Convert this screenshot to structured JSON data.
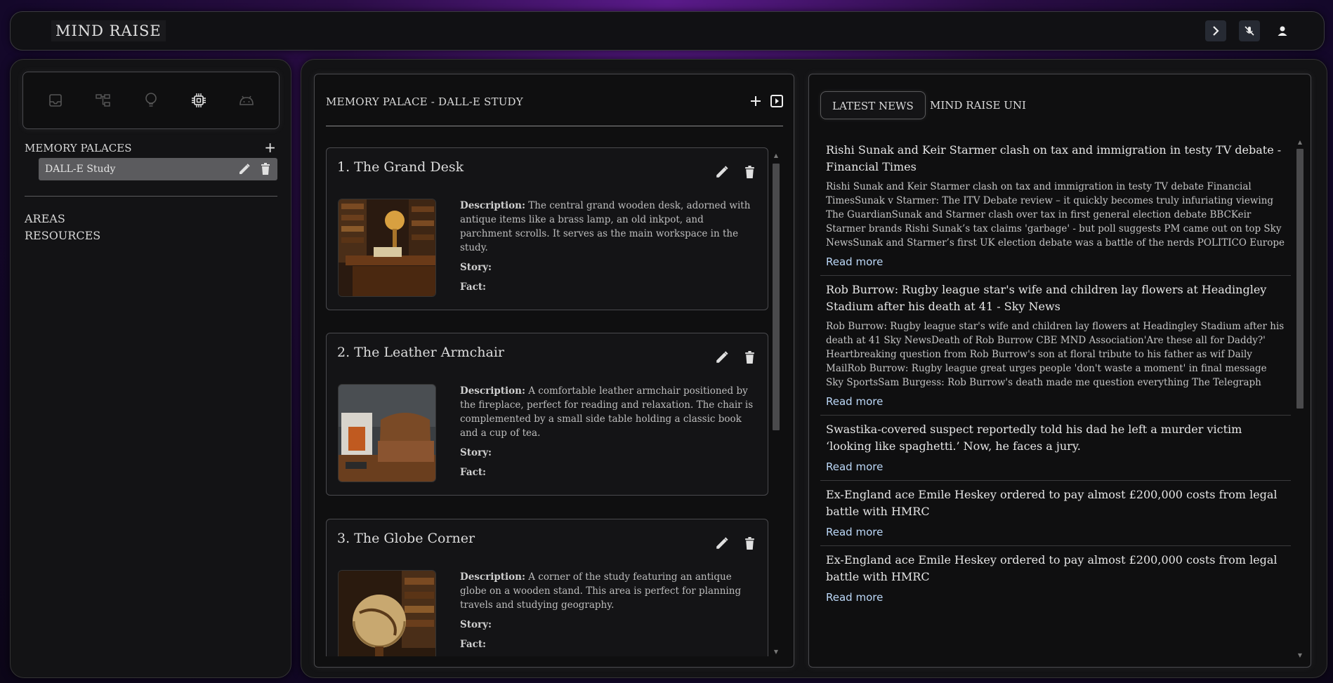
{
  "header": {
    "brand": "MIND RAISE",
    "icons": [
      "chevron-right-icon",
      "mic-off-icon",
      "user-icon"
    ]
  },
  "sidebar": {
    "icons": [
      "inbox-icon",
      "tree-icon",
      "bulb-icon",
      "chip-icon",
      "android-icon"
    ],
    "memory_palaces_label": "MEMORY PALACES",
    "palaces": [
      {
        "label": "DALL-E Study"
      }
    ],
    "areas_label": "AREAS",
    "resources_label": "RESOURCES"
  },
  "palace": {
    "title": "MEMORY PALACE - DALL-E STUDY",
    "description_label": "Description:",
    "story_label": "Story:",
    "fact_label": "Fact:",
    "loci": [
      {
        "title": "1. The Grand Desk",
        "description": "The central grand wooden desk, adorned with antique items like a brass lamp, an old inkpot, and parchment scrolls. It serves as the main workspace in the study.",
        "story": "",
        "fact": ""
      },
      {
        "title": "2. The Leather Armchair",
        "description": "A comfortable leather armchair positioned by the fireplace, perfect for reading and relaxation. The chair is complemented by a small side table holding a classic book and a cup of tea.",
        "story": "",
        "fact": ""
      },
      {
        "title": "3. The Globe Corner",
        "description": "A corner of the study featuring an antique globe on a wooden stand. This area is perfect for planning travels and studying geography.",
        "story": "",
        "fact": ""
      }
    ]
  },
  "news": {
    "tabs": [
      "LATEST NEWS",
      "MIND RAISE UNI"
    ],
    "read_more": "Read more",
    "items": [
      {
        "title": "Rishi Sunak and Keir Starmer clash on tax and immigration in testy TV debate - Financial Times",
        "desc": "Rishi Sunak and Keir Starmer clash on tax and immigration in testy TV debate Financial TimesSunak v Starmer: The ITV Debate review – it quickly becomes truly infuriating viewing The GuardianSunak and Starmer clash over tax in first general election debate BBCKeir Starmer brands Rishi Sunak’s tax claims 'garbage' - but poll suggests PM came out on top Sky NewsSunak and Starmer’s first UK election debate was a battle of the nerds POLITICO Europe"
      },
      {
        "title": "Rob Burrow: Rugby league star's wife and children lay flowers at Headingley Stadium after his death at 41 - Sky News",
        "desc": "Rob Burrow: Rugby league star's wife and children lay flowers at Headingley Stadium after his death at 41 Sky NewsDeath of Rob Burrow CBE MND Association'Are these all for Daddy?' Heartbreaking question from Rob Burrow's son at floral tribute to his father as wif Daily MailRob Burrow: Rugby league great urges people 'don't waste a moment' in final message Sky SportsSam Burgess: Rob Burrow's death made me question everything The Telegraph"
      },
      {
        "title": "Swastika-covered suspect reportedly told his dad he left a murder victim ‘looking like spaghetti.’ Now, he faces a jury.",
        "desc": ""
      },
      {
        "title": "Ex-England ace Emile Heskey ordered to pay almost £200,000 costs from legal battle with HMRC",
        "desc": ""
      },
      {
        "title": "Ex-England ace Emile Heskey ordered to pay almost £200,000 costs from legal battle with HMRC",
        "desc": ""
      }
    ]
  }
}
